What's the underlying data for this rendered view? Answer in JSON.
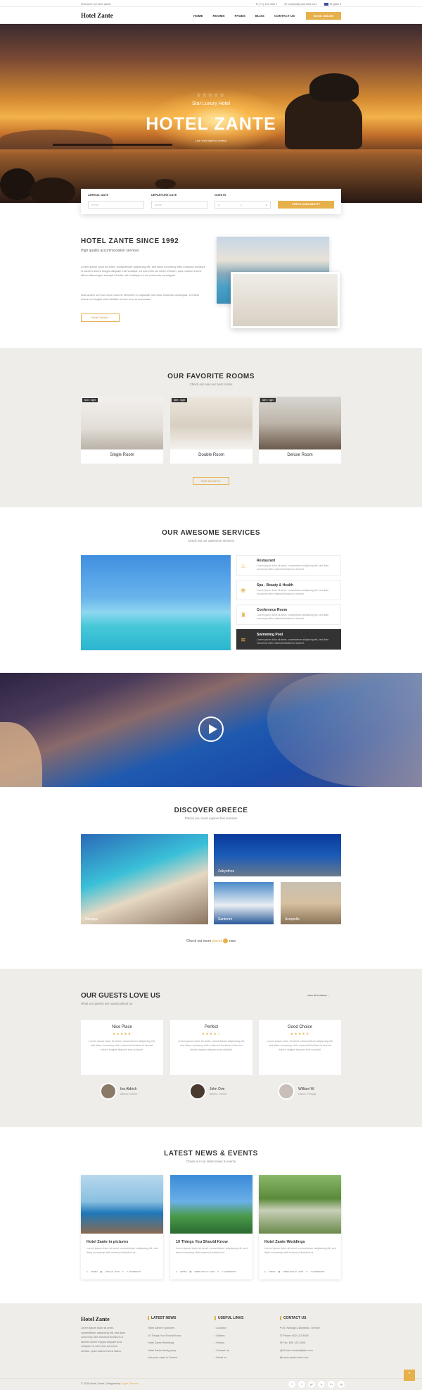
{
  "topbar": {
    "welcome": "Welcome to Hotel Zante",
    "phone": "(+1) 123 456 7",
    "email": "contact@yourhotel.com",
    "language": "English"
  },
  "header": {
    "logo": "Hotel Zante",
    "nav": [
      "HOME",
      "ROOMS",
      "PAGES",
      "BLOG",
      "CONTACT US"
    ],
    "book": "BOOK ONLINE"
  },
  "hero": {
    "stars": "☆☆☆☆☆",
    "subtitle": "Star Luxury Hotel",
    "title": "HOTEL ZANTE",
    "tagline": "Live Your Myth in Greece"
  },
  "booking": {
    "arrival_label": "ARRIVAL DATE",
    "arrival_placeholder": "Arrival",
    "departure_label": "DEPARTURE DATE",
    "departure_placeholder": "Arrival",
    "guests_label": "GUESTS",
    "guests_value": "1",
    "check": "CHECK AVAILABILITY"
  },
  "about": {
    "title": "HOTEL ZANTE SINCE 1992",
    "subtitle": "High quality accommodation services",
    "p1": "Lorem ipsum dolor sit amet, consectetuer adipiscing elit, sed diam nonummy nibh euismod tincidunt ut laoreet dolore magna aliquam erat volutpat. Ut wisi enim ad minim veniam, quis nostrud exerci tation ullamcorper suscipit lobortis nisl ut aliquip ex ea commodo consequat.",
    "p2": "Duis autem vel eum iriure dolor in hendrerit in vulputate velit esse molestie consequat, vel illum dolore eu feugiat nulla facilisis at vero eros et accumsan.",
    "more": "More Details"
  },
  "rooms": {
    "title": "OUR FAVORITE ROOMS",
    "subtitle": "Check out now our best rooms",
    "items": [
      {
        "price": "$20 / night",
        "name": "Single Room"
      },
      {
        "price": "$89 / night",
        "name": "Double Room"
      },
      {
        "price": "$89 / night",
        "name": "Deluxe Room"
      }
    ],
    "view_all": "View all rooms"
  },
  "services": {
    "title": "OUR AWESOME SERVICES",
    "subtitle": "Check out our awesome services",
    "items": [
      {
        "title": "Restaurant",
        "desc": "Lorem ipsum dolor sit amet, consectetuer adipiscing elit, sed diam nonummy nibh euismod tincidunt ut laoreet."
      },
      {
        "title": "Spa - Beauty & Health",
        "desc": "Lorem ipsum dolor sit amet, consectetuer adipiscing elit, sed diam nonummy nibh euismod tincidunt ut laoreet."
      },
      {
        "title": "Conference Room",
        "desc": "Lorem ipsum dolor sit amet, consectetuer adipiscing elit, sed diam nonummy nibh euismod tincidunt ut laoreet."
      },
      {
        "title": "Swimming Pool",
        "desc": "Lorem ipsum dolor sit amet, consectetuer adipiscing elit, sed diam nonummy nibh euismod tincidunt ut laoreet."
      }
    ]
  },
  "discover": {
    "title": "DISCOVER GREECE",
    "subtitle": "Places you must explore this summer",
    "tiles": [
      "Navagio",
      "Zakynthos",
      "Santorini",
      "Acropolis"
    ],
    "more_pre": "Check out more",
    "more_link": "places",
    "more_post": "now"
  },
  "guests": {
    "title": "OUR GUESTS LOVE US",
    "subtitle": "What our guests are saying about us",
    "view_all": "view all reviews",
    "reviews": [
      {
        "title": "Nice Place",
        "stars": "★★★★★",
        "text": "Lorem ipsum dolor sit amet, consectetuer adipiscing elit, sed diam nonummy nibh euismod tincidunt ut laoreet dolore magna aliquam erat volutpat.",
        "name": "Ina Aldrich",
        "city": "Athens, Greece"
      },
      {
        "title": "Perfect",
        "stars": "★★★★☆",
        "text": "Lorem ipsum dolor sit amet, consectetuer adipiscing elit, sed diam nonummy nibh euismod tincidunt ut laoreet dolore magna aliquam erat volutpat.",
        "name": "John Doe",
        "city": "Athens, Greece"
      },
      {
        "title": "Good Choice",
        "stars": "★★★★★",
        "text": "Lorem ipsum dolor sit amet, consectetuer adipiscing elit, sed diam nonummy nibh euismod tincidunt ut laoreet dolore magna aliquam erat volutpat.",
        "name": "William W.",
        "city": "Lisbon, Portugal"
      }
    ]
  },
  "news": {
    "title": "LATEST NEWS & EVENTS",
    "subtitle": "Check out our latest news & events",
    "items": [
      {
        "title": "Hotel Zante in pictures",
        "text": "Lorem ipsum dolor sit amet, consectetuer adipiscing elit, sed diam nonummy nibh euismod tincidunt ut...",
        "author": "ADMIN",
        "date": "JUNE 27, 2018",
        "comments": "0 COMMENTS"
      },
      {
        "title": "10 Things You Should Know",
        "text": "Lorem ipsum dolor sit amet, consectetuer adipiscing elit, sed diam nonummy nibh euismod tincidunt ut...",
        "author": "ADMIN",
        "date": "FEBRUARY 27, 2018",
        "comments": "0 COMMENTS"
      },
      {
        "title": "Hotel Zante Weddings",
        "text": "Lorem ipsum dolor sit amet, consectetuer adipiscing elit, sed diam nonummy nibh euismod tincidunt ut...",
        "author": "ADMIN",
        "date": "FEBRUARY 27, 2018",
        "comments": "0 COMMENTS"
      }
    ]
  },
  "footer": {
    "logo": "Hotel Zante",
    "about": "Lorem ipsum dolor sit amet, consectetuer adipiscing elit, sed diam nonummy nibh euismod tincidunt ut laoreet dolore magna aliquam erat volutpat. Ut wisi enim ad minim veniam, quis nostrud exerci tation.",
    "news_title": "LATEST NEWS",
    "news": [
      "Hotel Zante in pictures",
      "10 Things You Should Know",
      "Hotel Zante Weddings",
      "Hotel Zante family party",
      "Live your myth in Greece"
    ],
    "links_title": "USEFUL LINKS",
    "links": [
      "Location",
      "Gallery",
      "History",
      "Contact us",
      "About us"
    ],
    "contact_title": "CONTACT US",
    "contact": [
      "25, Navagio Zakynthos, Greece",
      "Phone: 800 123 3456",
      "Fax: 800 123 3456",
      "Email: contact@site.com",
      "www.zante-hotel.com"
    ],
    "copy_pre": "© 2018 Hotel Zante. Designed by",
    "copy_author": "Eagle Themes",
    "social": [
      "f",
      "t",
      "g+",
      "p",
      "in",
      "ig"
    ]
  },
  "colors": {
    "accent": "#e6b04b",
    "dark": "#333333",
    "section_bg": "#efedea"
  }
}
